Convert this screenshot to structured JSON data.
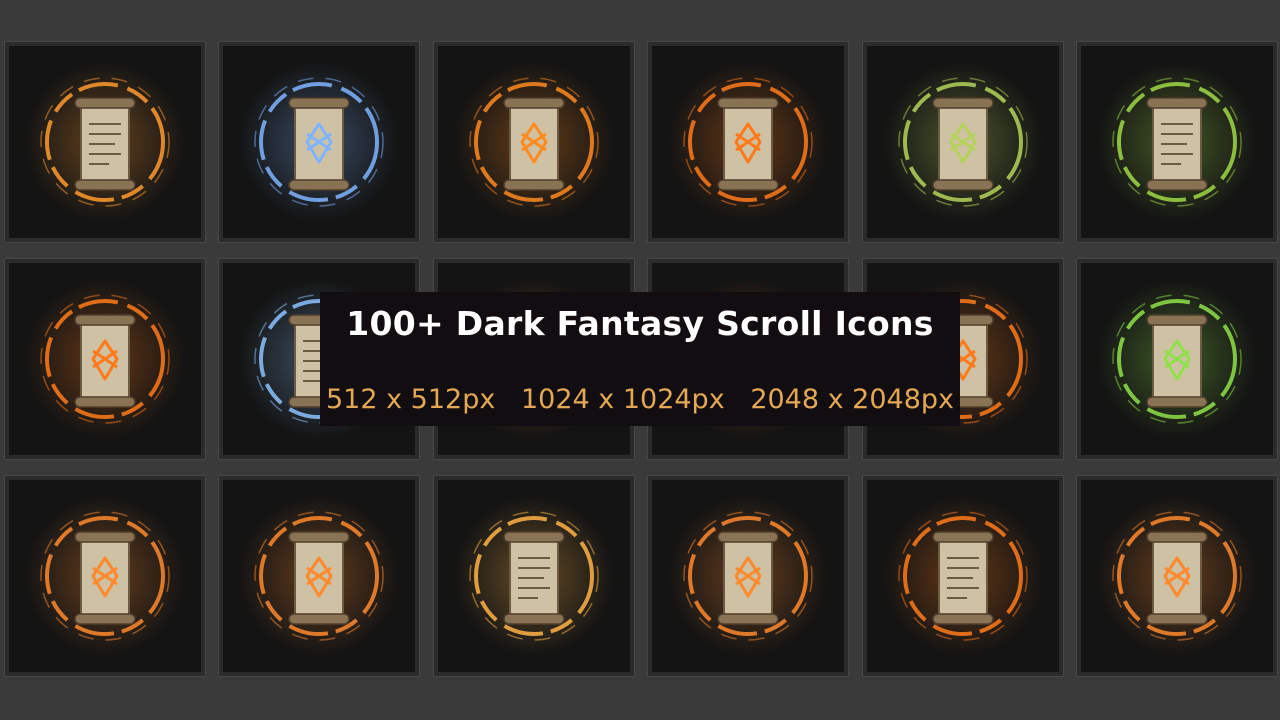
{
  "banner": {
    "title": "100+ Dark Fantasy Scroll Icons",
    "sizes": [
      "512 x 512px",
      "1024 x 1024px",
      "2048 x 2048px"
    ]
  },
  "colors": {
    "page_background": "#3a3a3a",
    "tile_background": "#141414",
    "banner_background": "#120d10",
    "title_text": "#ffffff",
    "size_text": "#e4a855"
  },
  "icons": [
    {
      "name": "fire-ring-scroll-icon",
      "glow": "#ff9a2e",
      "rune": false
    },
    {
      "name": "frost-ring-scroll-icon",
      "glow": "#7fb4ff",
      "rune": true
    },
    {
      "name": "flame-rune-scroll-icon",
      "glow": "#ff8a1e",
      "rune": true
    },
    {
      "name": "ember-rune-scroll-icon",
      "glow": "#ff7a1a",
      "rune": true
    },
    {
      "name": "skull-sigil-scroll-icon",
      "glow": "#b5d35a",
      "rune": true
    },
    {
      "name": "bone-lightning-scroll-icon",
      "glow": "#9fd845",
      "rune": false
    },
    {
      "name": "fire-swirl-scroll-icon",
      "glow": "#ff7a1a",
      "rune": true
    },
    {
      "name": "frost-swirl-scroll-icon",
      "glow": "#8cc2ff",
      "rune": false
    },
    {
      "name": "shadow-scroll-icon",
      "glow": "#ff8a2e",
      "rune": false
    },
    {
      "name": "flame-wisp-scroll-icon",
      "glow": "#ff6a1a",
      "rune": false
    },
    {
      "name": "fire-sigil-scroll-icon",
      "glow": "#ff7a1a",
      "rune": true
    },
    {
      "name": "nature-ring-scroll-icon",
      "glow": "#8fe04a",
      "rune": true
    },
    {
      "name": "vine-rune-scroll-icon",
      "glow": "#ff8a2e",
      "rune": true
    },
    {
      "name": "burning-scroll-icon",
      "glow": "#ff8a2e",
      "rune": true
    },
    {
      "name": "crystal-scroll-icon",
      "glow": "#ffb347",
      "rune": false
    },
    {
      "name": "stone-orbit-scroll-icon",
      "glow": "#ff8a2e",
      "rune": true
    },
    {
      "name": "fire-vortex-scroll-icon",
      "glow": "#ff7a1a",
      "rune": false
    },
    {
      "name": "lily-rune-scroll-icon",
      "glow": "#ff8a2e",
      "rune": true
    }
  ]
}
